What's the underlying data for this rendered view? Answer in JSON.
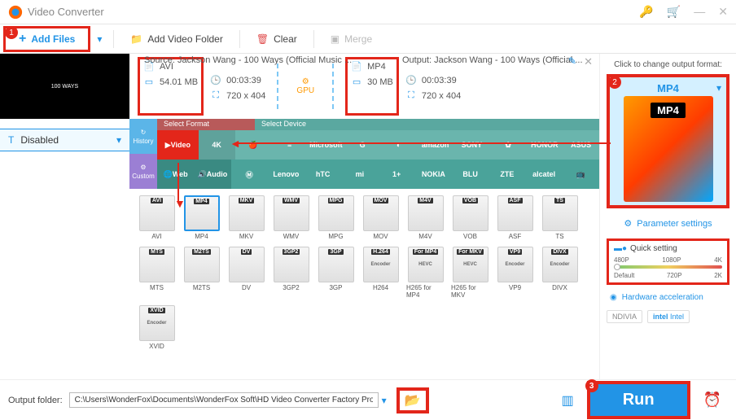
{
  "title": "Video Converter",
  "toolbar": {
    "add_files": "Add Files",
    "add_folder": "Add Video Folder",
    "clear": "Clear",
    "merge": "Merge"
  },
  "thumb_text": "100 WAYS",
  "disabled_label": "Disabled",
  "source": {
    "header": "Source: Jackson Wang - 100 Ways (Official Music ...",
    "format": "AVI",
    "duration": "00:03:39",
    "size": "54.01 MB",
    "resolution": "720 x 404"
  },
  "gpu_label": "GPU",
  "output": {
    "header": "Output: Jackson Wang - 100 Ways (Official ...",
    "format": "MP4",
    "duration": "00:03:39",
    "size": "30 MB",
    "resolution": "720 x 404"
  },
  "tabs": {
    "history": "History",
    "custom": "Custom",
    "select_format": "Select Format",
    "select_device": "Select Device",
    "video": "Video",
    "web": "Web",
    "audio": "Audio",
    "brands_r1": [
      "",
      "Microsoft",
      "",
      "",
      "amazon",
      "SONY",
      "",
      "HONOR",
      "ASUS"
    ],
    "brands_r2": [
      "",
      "Lenovo",
      "hTC",
      "",
      "",
      "NOKIA",
      "BLU",
      "ZTE",
      "alcatel",
      ""
    ]
  },
  "formats_row1": [
    "AVI",
    "MP4",
    "MKV",
    "WMV",
    "MPG",
    "MOV",
    "M4V",
    "VOB",
    "ASF",
    "TS"
  ],
  "formats_row2": [
    "MTS",
    "M2TS",
    "DV",
    "3GP2",
    "3GP",
    "H264",
    "H265 for MP4",
    "H265 for MKV",
    "VP9",
    "DIVX"
  ],
  "formats_row2_tags": [
    "MTS",
    "M2TS",
    "DV",
    "3GP2",
    "3GP",
    "H.264",
    "For MP4",
    "For MKV",
    "VP9",
    "DIVX"
  ],
  "formats_row2_sub": [
    "",
    "",
    "",
    "",
    "",
    "Encoder",
    "HEVC",
    "HEVC",
    "Encoder",
    "Encoder"
  ],
  "formats_row3": [
    "XVID"
  ],
  "formats_row3_sub": [
    "Encoder"
  ],
  "right": {
    "header": "Click to change output format:",
    "format": "MP4",
    "param": "Parameter settings",
    "quick": "Quick setting",
    "scale": [
      "480P",
      "1080P",
      "4K"
    ],
    "scale2": [
      "Default",
      "720P",
      "2K"
    ],
    "hw": "Hardware acceleration",
    "nvidia": "NDIVIA",
    "intel": "Intel"
  },
  "footer": {
    "label": "Output folder:",
    "path": "C:\\Users\\WonderFox\\Documents\\WonderFox Soft\\HD Video Converter Factory Pro\\OutputVideo\\",
    "run": "Run"
  },
  "steps": {
    "s1": "1",
    "s2": "2",
    "s3": "3"
  }
}
